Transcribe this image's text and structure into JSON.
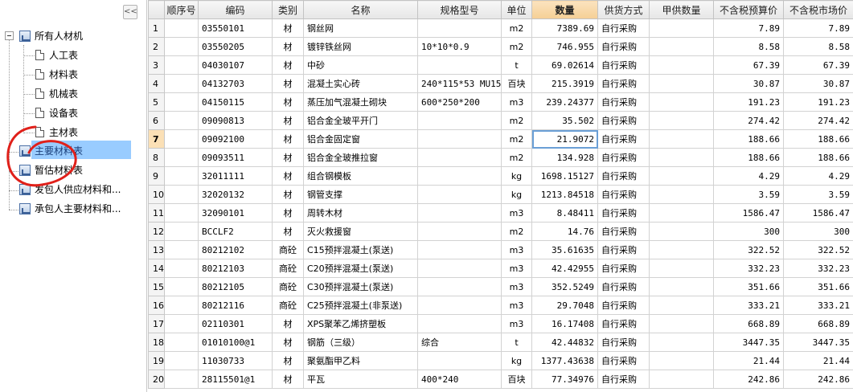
{
  "tree": {
    "collapse_label": "<<",
    "root_label": "所有人材机",
    "children": [
      {
        "label": "人工表"
      },
      {
        "label": "材料表"
      },
      {
        "label": "机械表"
      },
      {
        "label": "设备表"
      },
      {
        "label": "主材表"
      }
    ],
    "folders": [
      {
        "label": "主要材料表",
        "selected": true
      },
      {
        "label": "暂估材料表"
      },
      {
        "label": "发包人供应材料和..."
      },
      {
        "label": "承包人主要材料和..."
      }
    ]
  },
  "grid": {
    "columns": [
      "",
      "顺序号",
      "编码",
      "类别",
      "名称",
      "规格型号",
      "单位",
      "数量",
      "供货方式",
      "甲供数量",
      "不含税预算价",
      "不含税市场价"
    ],
    "active_row": 7,
    "rows": [
      {
        "n": "1",
        "code": "03550101",
        "type": "材",
        "name": "钢丝网",
        "spec": "",
        "unit": "m2",
        "qty": "7389.69",
        "supply": "自行采购",
        "jia": "",
        "budget": "7.89",
        "market": "7.89"
      },
      {
        "n": "2",
        "code": "03550205",
        "type": "材",
        "name": "镀锌铁丝网",
        "spec": "10*10*0.9",
        "unit": "m2",
        "qty": "746.955",
        "supply": "自行采购",
        "jia": "",
        "budget": "8.58",
        "market": "8.58"
      },
      {
        "n": "3",
        "code": "04030107",
        "type": "材",
        "name": "中砂",
        "spec": "",
        "unit": "t",
        "qty": "69.02614",
        "supply": "自行采购",
        "jia": "",
        "budget": "67.39",
        "market": "67.39"
      },
      {
        "n": "4",
        "code": "04132703",
        "type": "材",
        "name": "混凝土实心砖",
        "spec": "240*115*53 MU15",
        "unit": "百块",
        "qty": "215.3919",
        "supply": "自行采购",
        "jia": "",
        "budget": "30.87",
        "market": "30.87"
      },
      {
        "n": "5",
        "code": "04150115",
        "type": "材",
        "name": "蒸压加气混凝土砌块",
        "spec": "600*250*200",
        "unit": "m3",
        "qty": "239.24377",
        "supply": "自行采购",
        "jia": "",
        "budget": "191.23",
        "market": "191.23"
      },
      {
        "n": "6",
        "code": "09090813",
        "type": "材",
        "name": "铝合金全玻平开门",
        "spec": "",
        "unit": "m2",
        "qty": "35.502",
        "supply": "自行采购",
        "jia": "",
        "budget": "274.42",
        "market": "274.42"
      },
      {
        "n": "7",
        "code": "09092100",
        "type": "材",
        "name": "铝合金固定窗",
        "spec": "",
        "unit": "m2",
        "qty": "21.9072",
        "supply": "自行采购",
        "jia": "",
        "budget": "188.66",
        "market": "188.66"
      },
      {
        "n": "8",
        "code": "09093511",
        "type": "材",
        "name": "铝合金全玻推拉窗",
        "spec": "",
        "unit": "m2",
        "qty": "134.928",
        "supply": "自行采购",
        "jia": "",
        "budget": "188.66",
        "market": "188.66"
      },
      {
        "n": "9",
        "code": "32011111",
        "type": "材",
        "name": "组合钢模板",
        "spec": "",
        "unit": "kg",
        "qty": "1698.15127",
        "supply": "自行采购",
        "jia": "",
        "budget": "4.29",
        "market": "4.29"
      },
      {
        "n": "10",
        "code": "32020132",
        "type": "材",
        "name": "钢管支撑",
        "spec": "",
        "unit": "kg",
        "qty": "1213.84518",
        "supply": "自行采购",
        "jia": "",
        "budget": "3.59",
        "market": "3.59"
      },
      {
        "n": "11",
        "code": "32090101",
        "type": "材",
        "name": "周转木材",
        "spec": "",
        "unit": "m3",
        "qty": "8.48411",
        "supply": "自行采购",
        "jia": "",
        "budget": "1586.47",
        "market": "1586.47"
      },
      {
        "n": "12",
        "code": "BCCLF2",
        "type": "材",
        "name": "灭火救援窗",
        "spec": "",
        "unit": "m2",
        "qty": "14.76",
        "supply": "自行采购",
        "jia": "",
        "budget": "300",
        "market": "300"
      },
      {
        "n": "13",
        "code": "80212102",
        "type": "商砼",
        "name": "C15预拌混凝土(泵送)",
        "spec": "",
        "unit": "m3",
        "qty": "35.61635",
        "supply": "自行采购",
        "jia": "",
        "budget": "322.52",
        "market": "322.52"
      },
      {
        "n": "14",
        "code": "80212103",
        "type": "商砼",
        "name": "C20预拌混凝土(泵送)",
        "spec": "",
        "unit": "m3",
        "qty": "42.42955",
        "supply": "自行采购",
        "jia": "",
        "budget": "332.23",
        "market": "332.23"
      },
      {
        "n": "15",
        "code": "80212105",
        "type": "商砼",
        "name": "C30预拌混凝土(泵送)",
        "spec": "",
        "unit": "m3",
        "qty": "352.5249",
        "supply": "自行采购",
        "jia": "",
        "budget": "351.66",
        "market": "351.66"
      },
      {
        "n": "16",
        "code": "80212116",
        "type": "商砼",
        "name": "C25预拌混凝土(非泵送)",
        "spec": "",
        "unit": "m3",
        "qty": "29.7048",
        "supply": "自行采购",
        "jia": "",
        "budget": "333.21",
        "market": "333.21"
      },
      {
        "n": "17",
        "code": "02110301",
        "type": "材",
        "name": "XPS聚苯乙烯挤塑板",
        "spec": "",
        "unit": "m3",
        "qty": "16.17408",
        "supply": "自行采购",
        "jia": "",
        "budget": "668.89",
        "market": "668.89"
      },
      {
        "n": "18",
        "code": "01010100@1",
        "type": "材",
        "name": "钢筋（三级）",
        "spec": "综合",
        "unit": "t",
        "qty": "42.44832",
        "supply": "自行采购",
        "jia": "",
        "budget": "3447.35",
        "market": "3447.35"
      },
      {
        "n": "19",
        "code": "11030733",
        "type": "材",
        "name": "聚氨酯甲乙料",
        "spec": "",
        "unit": "kg",
        "qty": "1377.43638",
        "supply": "自行采购",
        "jia": "",
        "budget": "21.44",
        "market": "21.44"
      },
      {
        "n": "20",
        "code": "28115501@1",
        "type": "材",
        "name": "平瓦",
        "spec": "400*240",
        "unit": "百块",
        "qty": "77.34976",
        "supply": "自行采购",
        "jia": "",
        "budget": "242.86",
        "market": "242.86"
      }
    ]
  },
  "colors": {
    "selection": "#99ccff",
    "qty_header": "#f5cf95",
    "active_row": "#fbe0b6",
    "annotation": "#e0201a"
  }
}
